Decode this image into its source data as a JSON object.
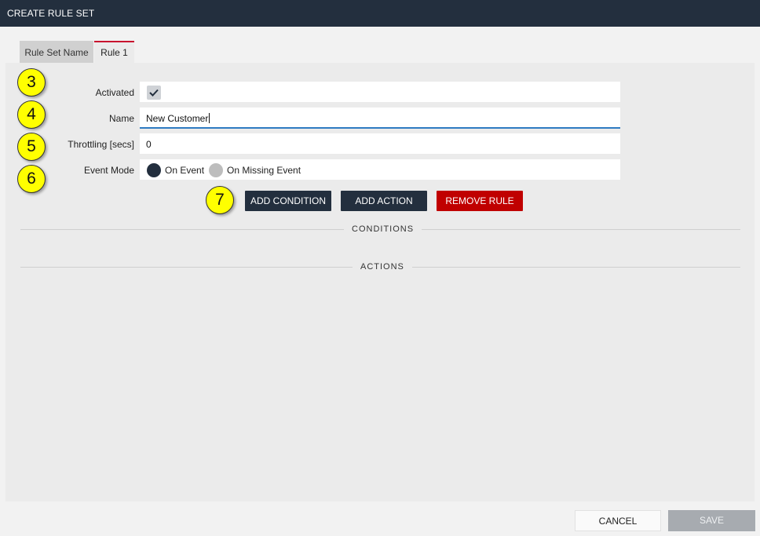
{
  "window": {
    "title": "CREATE RULE SET"
  },
  "tabs": [
    {
      "label": "Rule Set Name",
      "active": false
    },
    {
      "label": "Rule 1",
      "active": true
    }
  ],
  "form": {
    "activated": {
      "label": "Activated",
      "checked": true
    },
    "name": {
      "label": "Name",
      "value": "New Customer"
    },
    "throttling": {
      "label": "Throttling [secs]",
      "value": "0"
    },
    "event_mode": {
      "label": "Event Mode",
      "options": [
        {
          "label": "On Event",
          "selected": true
        },
        {
          "label": "On Missing Event",
          "selected": false
        }
      ]
    }
  },
  "actions": {
    "add_condition": "ADD CONDITION",
    "add_action": "ADD ACTION",
    "remove_rule": "REMOVE RULE"
  },
  "sections": {
    "conditions": "CONDITIONS",
    "actions": "ACTIONS"
  },
  "callouts": [
    "3",
    "4",
    "5",
    "6",
    "7"
  ],
  "footer": {
    "cancel": "CANCEL",
    "save": "SAVE"
  },
  "colors": {
    "header": "#232f3e",
    "accent": "#c8102e",
    "danger": "#c00000",
    "focus": "#2e7bc2",
    "callout": "#ffff00"
  }
}
